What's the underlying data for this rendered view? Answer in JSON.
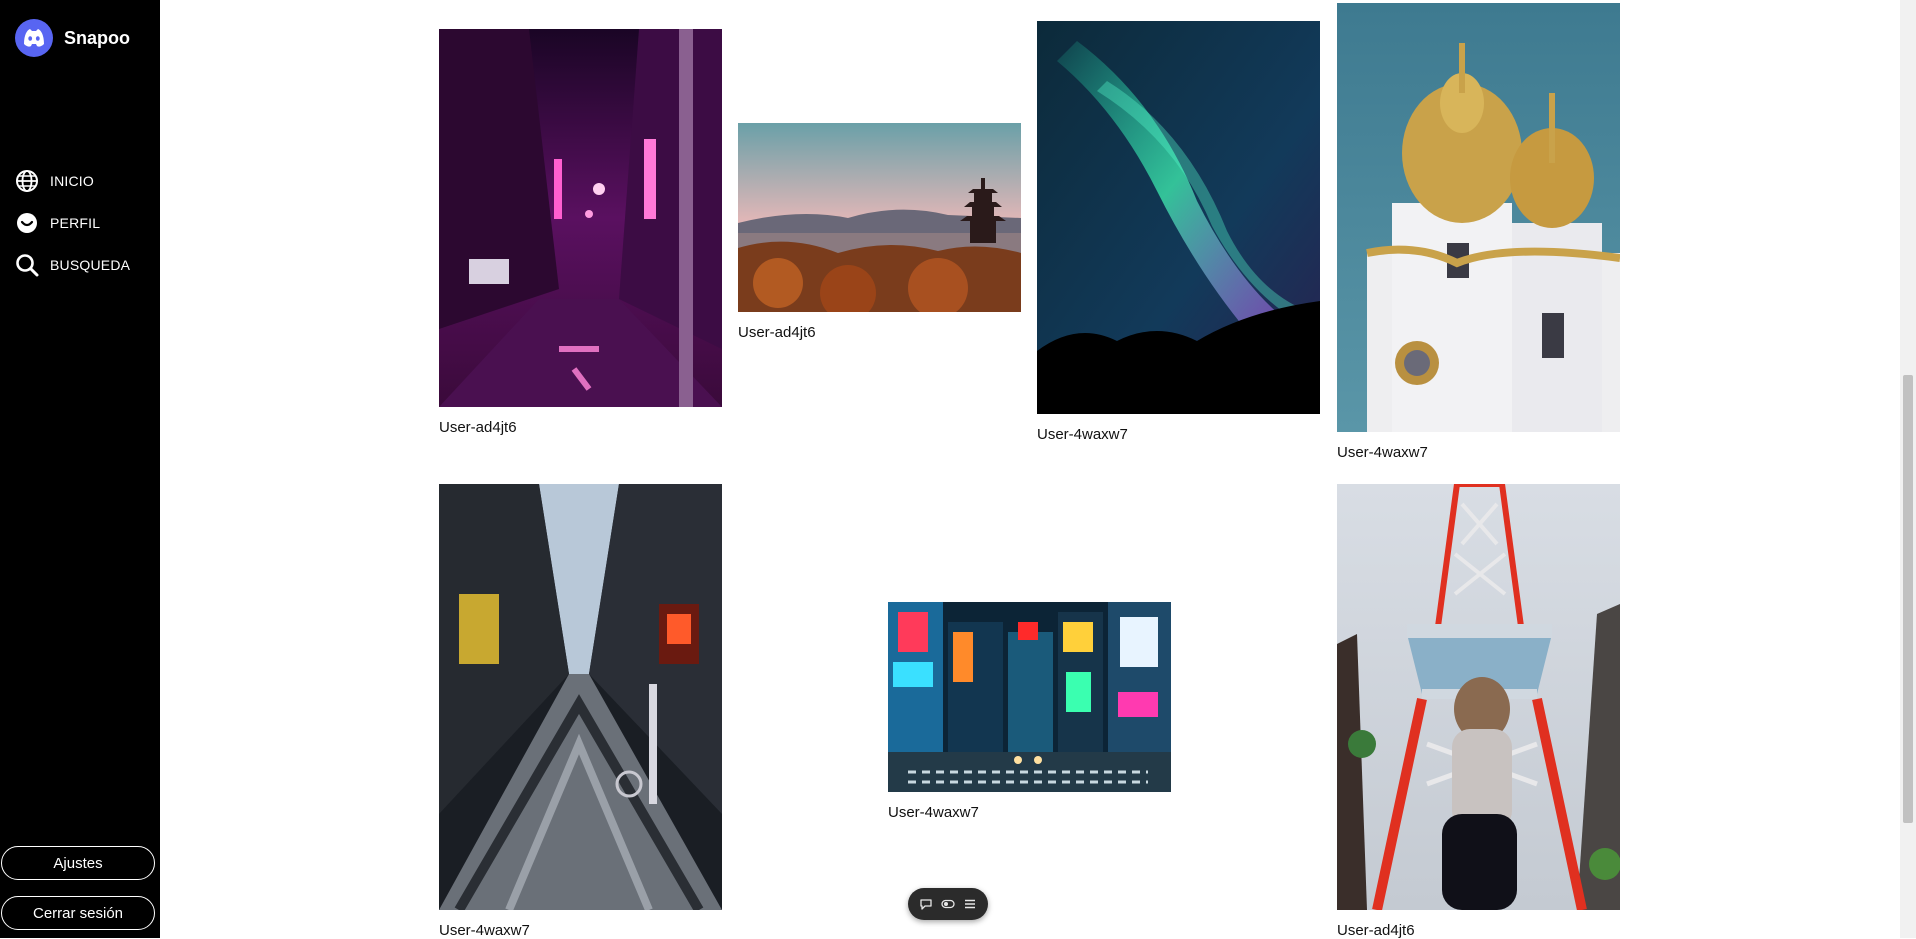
{
  "app": {
    "name": "Snapoo",
    "logo_icon": "discord-like-logo-icon",
    "accent": "#5865F2"
  },
  "sidebar": {
    "items": [
      {
        "label": "INICIO",
        "icon": "globe-icon"
      },
      {
        "label": "PERFIL",
        "icon": "smiley-icon"
      },
      {
        "label": "BUSQUEDA",
        "icon": "search-icon"
      }
    ],
    "settings_label": "Ajustes",
    "logout_label": "Cerrar sesión"
  },
  "posts": [
    {
      "user": "User-ad4jt6",
      "subject": "neon street at night"
    },
    {
      "user": "User-ad4jt6",
      "subject": "pagoda at sunset"
    },
    {
      "user": "User-4waxw7",
      "subject": "aurora over mountains"
    },
    {
      "user": "User-4waxw7",
      "subject": "golden domed church"
    },
    {
      "user": "User-4waxw7",
      "subject": "covered shopping arcade"
    },
    {
      "user": "User-4waxw7",
      "subject": "city crossing at night"
    },
    {
      "user": "User-ad4jt6",
      "subject": "red and white tower"
    }
  ],
  "floating_toolbar": {
    "icons": [
      "chat-bubble-icon",
      "toggle-icon",
      "menu-icon"
    ]
  }
}
